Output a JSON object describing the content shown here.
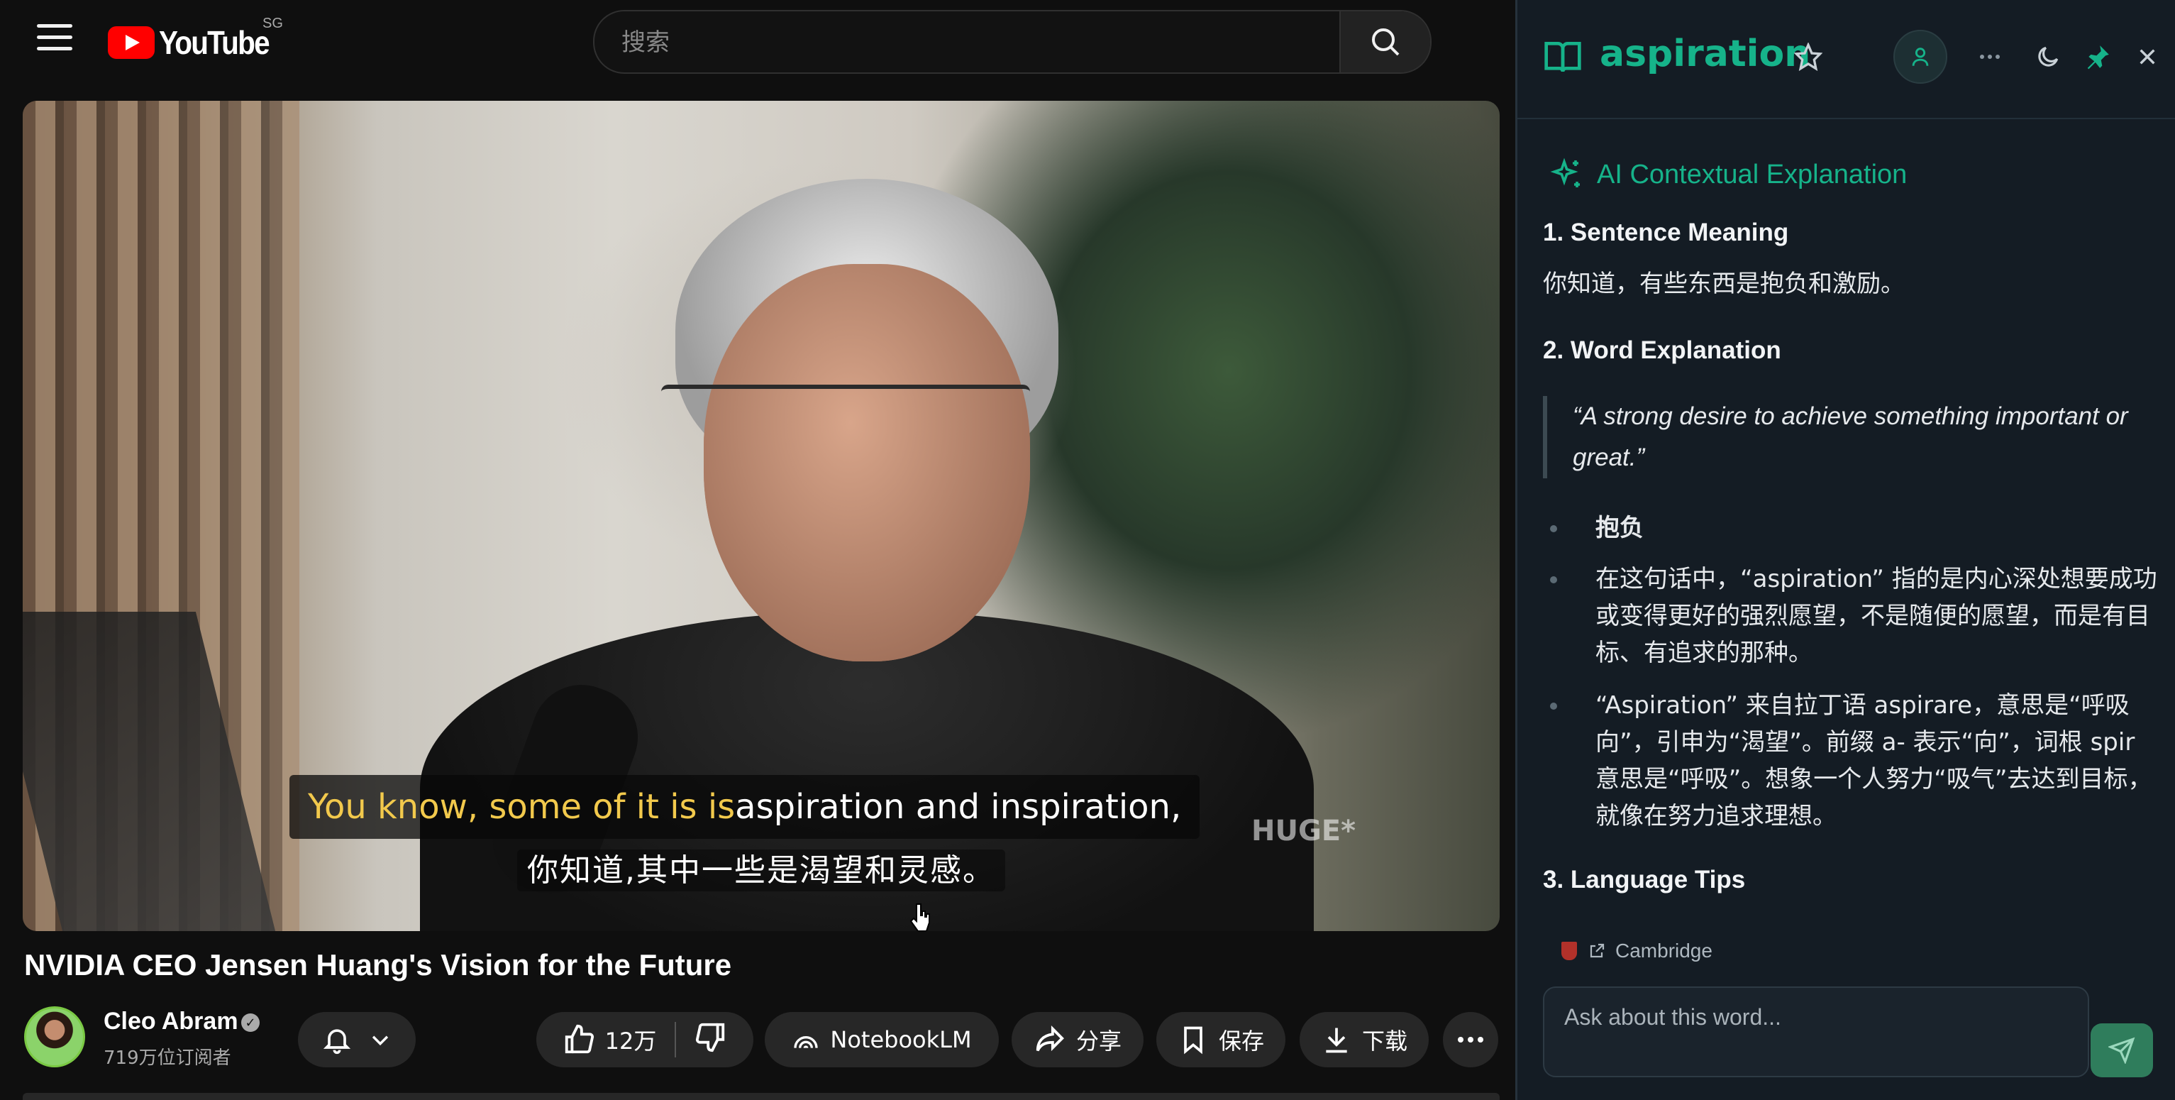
{
  "header": {
    "logo_text": "YouTube",
    "region": "SG",
    "search_placeholder": "搜索"
  },
  "video": {
    "caption_highlight": "You know, some of it is is",
    "caption_rest": " aspiration and inspiration,",
    "caption_translation": "你知道,其中一些是渴望和灵感。",
    "watermark": "HUGE*"
  },
  "meta": {
    "title": "NVIDIA CEO Jensen Huang's Vision for the Future",
    "channel_name": "Cleo Abram",
    "subscribers": "719万位订阅者",
    "like_count": "12万",
    "notebook_label": "NotebookLM",
    "share_label": "分享",
    "save_label": "保存",
    "download_label": "下载"
  },
  "panel": {
    "word": "aspiration",
    "ai_title": "AI Contextual Explanation",
    "section1_title": "1. Sentence Meaning",
    "sentence_meaning": "你知道，有些东西是抱负和激励。",
    "section2_title": "2. Word Explanation",
    "definition_quote": "“A strong desire to achieve something important or great.”",
    "bullets": [
      "抱负",
      "在这句话中，“aspiration” 指的是内心深处想要成功或变得更好的强烈愿望，不是随便的愿望，而是有目标、有追求的那种。",
      "“Aspiration” 来自拉丁语 aspirare，意思是“呼吸向”，引申为“渴望”。前缀 a- 表示“向”，词根 spir 意思是“呼吸”。想象一个人努力“吸气”去达到目标，就像在努力追求理想。"
    ],
    "section3_title": "3. Language Tips",
    "source_label": "Cambridge",
    "ask_placeholder": "Ask about this word..."
  },
  "colors": {
    "accent": "#16b38a",
    "caption_highlight": "#f2c94c",
    "youtube_red": "#ff0000",
    "panel_bg": "#141c24"
  },
  "icons": [
    "menu-icon",
    "youtube-logo",
    "search-icon",
    "book-icon",
    "star-icon",
    "user-icon",
    "more-icon",
    "moon-icon",
    "pin-icon",
    "close-icon",
    "sparkle-icon",
    "like-icon",
    "dislike-icon",
    "bell-icon",
    "chevron-down-icon",
    "notebooklm-icon",
    "share-icon",
    "bookmark-icon",
    "download-icon",
    "verified-icon",
    "cambridge-icon",
    "external-link-icon",
    "send-icon"
  ]
}
